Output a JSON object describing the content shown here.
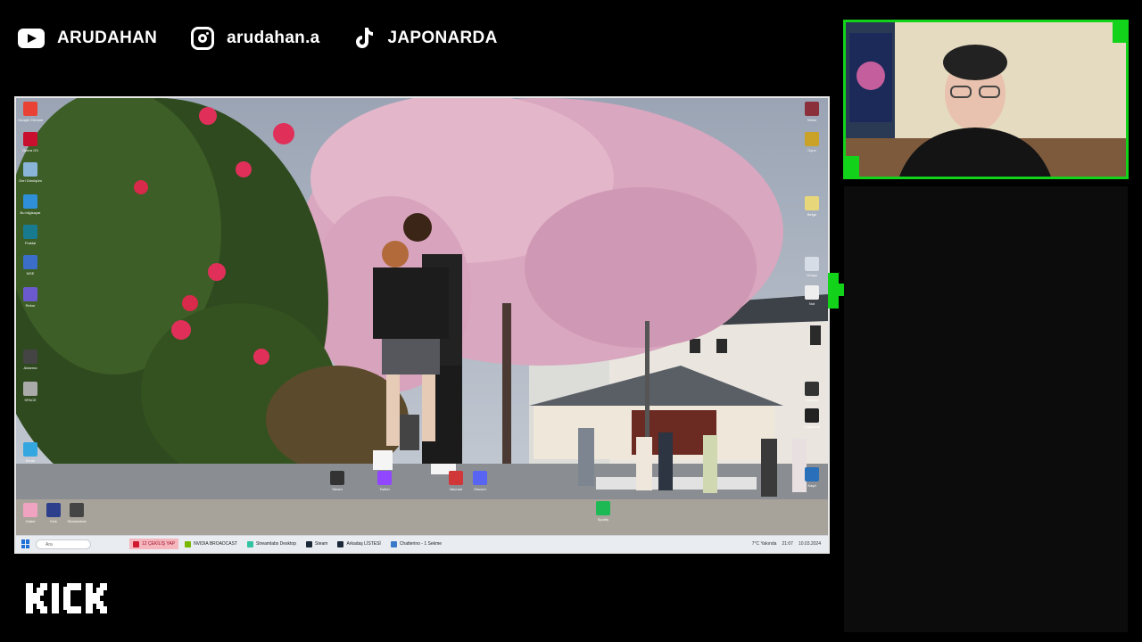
{
  "social": {
    "youtube": {
      "icon": "youtube-icon",
      "label": "ARUDAHAN"
    },
    "instagram": {
      "icon": "instagram-icon",
      "label": "arudahan.a"
    },
    "tiktok": {
      "icon": "tiktok-icon",
      "label": "JAPONARDA"
    }
  },
  "branding": {
    "logo_text": "KICK",
    "accent_color": "#12d21a"
  },
  "desktop": {
    "left_icons": [
      {
        "label": "Google Chrome",
        "color": "#e94235"
      },
      {
        "label": "Opera GX",
        "color": "#c8102e"
      },
      {
        "label": "Geri Dönüşüm",
        "color": "#8ab4d8"
      },
      {
        "label": "Bu bilgisayar",
        "color": "#2f8fd8"
      },
      {
        "label": "Fraktal",
        "color": "#177a8f"
      },
      {
        "label": "NGE",
        "color": "#3a6ec8"
      },
      {
        "label": "Rekor",
        "color": "#6a5acd"
      },
      {
        "label": "Aktarma",
        "color": "#444444"
      },
      {
        "label": "SPACE",
        "color": "#aaaaaa"
      },
      {
        "label": "Ekran",
        "color": "#35a7e0"
      }
    ],
    "right_icons": [
      {
        "label": "Video",
        "color": "#8b2f3a"
      },
      {
        "label": "Oyun",
        "color": "#c9a227"
      },
      {
        "label": "Belge",
        "color": "#e8d77a"
      },
      {
        "label": "Dosya",
        "color": "#d7dde6"
      },
      {
        "label": "Not",
        "color": "#eeeeee"
      },
      {
        "label": "Kamera",
        "color": "#333333"
      },
      {
        "label": "Uygulama",
        "color": "#222222"
      },
      {
        "label": "Kayıt",
        "color": "#2a6fba"
      }
    ],
    "bottom_icons": [
      {
        "label": "Galeri",
        "color": "#f0a3c0"
      },
      {
        "label": "Kick",
        "color": "#2d3e8c"
      },
      {
        "label": "Streamdeck",
        "color": "#444444"
      },
      {
        "label": "Steam",
        "color": "#333333"
      },
      {
        "label": "Twitch",
        "color": "#9146ff"
      },
      {
        "label": "Valorant",
        "color": "#d13639"
      },
      {
        "label": "Discord",
        "color": "#5865f2"
      },
      {
        "label": "Spotify",
        "color": "#1db954"
      }
    ]
  },
  "taskbar": {
    "search_placeholder": "Ara",
    "apps": [
      {
        "label": "12 ÇEKİLİŞ YAP",
        "color": "#d0192f",
        "active": true
      },
      {
        "label": "NVIDIA BROADCAST",
        "color": "#76b900",
        "active": false
      },
      {
        "label": "Streamlabs Desktop",
        "color": "#31c3a2",
        "active": false
      },
      {
        "label": "Steam",
        "color": "#1b2838",
        "active": false
      },
      {
        "label": "Arkadaş LİSTESİ",
        "color": "#1b2838",
        "active": false
      },
      {
        "label": "Chatterino - 1 Sekme",
        "color": "#3a78c9",
        "active": false
      }
    ],
    "tray": {
      "weather": "7°C Yakında",
      "time": "21:07",
      "date": "10.03.2024"
    }
  }
}
